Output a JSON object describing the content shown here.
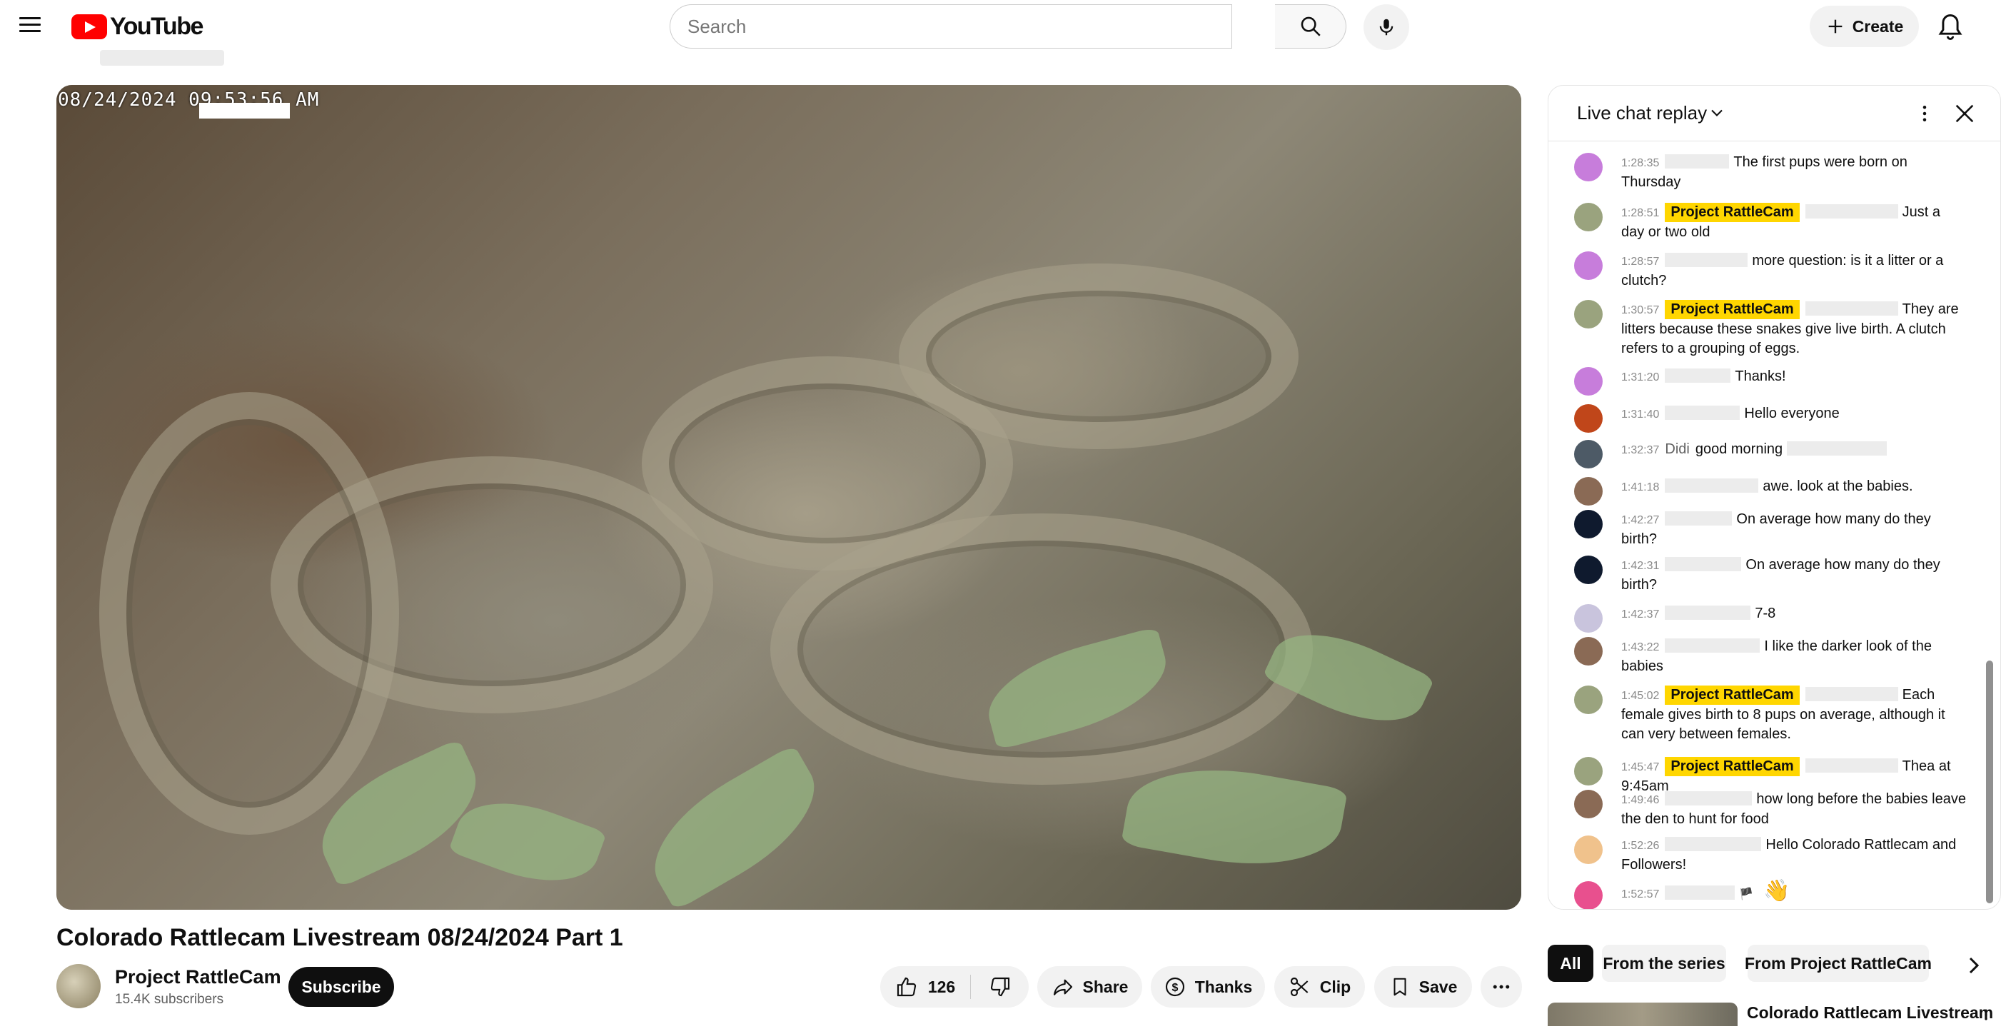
{
  "header": {
    "logo_text": "YouTube",
    "search_placeholder": "Search",
    "create_label": "Create"
  },
  "player": {
    "timestamp_overlay": "08/24/2024 09:53:56 AM"
  },
  "video": {
    "title": "Colorado Rattlecam Livestream 08/24/2024 Part 1",
    "channel_name": "Project RattleCam",
    "subscribers": "15.4K subscribers",
    "subscribe_label": "Subscribe",
    "like_count": "126",
    "share_label": "Share",
    "thanks_label": "Thanks",
    "clip_label": "Clip",
    "save_label": "Save"
  },
  "chat": {
    "title": "Live chat replay",
    "messages": [
      {
        "time": "1:28:35",
        "author": "",
        "moderator": false,
        "text": "The first pups were born on Thursday",
        "avatar_color": "#c77ddb"
      },
      {
        "time": "1:28:51",
        "author": "Project RattleCam",
        "moderator": true,
        "text": "Just a day or two old",
        "avatar_color": "#9aa37e"
      },
      {
        "time": "1:28:57",
        "author": "",
        "moderator": false,
        "text": "more question: is it a litter or a clutch?",
        "avatar_color": "#c77ddb"
      },
      {
        "time": "1:30:57",
        "author": "Project RattleCam",
        "moderator": true,
        "text": "They are litters because these snakes give live birth. A clutch refers to a grouping of eggs.",
        "avatar_color": "#9aa37e"
      },
      {
        "time": "1:31:20",
        "author": "",
        "moderator": false,
        "text": "Thanks!",
        "avatar_color": "#c77ddb"
      },
      {
        "time": "1:31:40",
        "author": "",
        "moderator": false,
        "text": "Hello everyone",
        "avatar_color": "#c0461a"
      },
      {
        "time": "1:32:37",
        "author": "Didi",
        "moderator": false,
        "text": "good morning",
        "avatar_color": "#4d5a66"
      },
      {
        "time": "1:41:18",
        "author": "",
        "moderator": false,
        "text": "awe. look at the babies.",
        "avatar_color": "#8a6a55"
      },
      {
        "time": "1:42:27",
        "author": "",
        "moderator": false,
        "text": "On average how many do they birth?",
        "avatar_color": "#0f1a2e"
      },
      {
        "time": "1:42:31",
        "author": "",
        "moderator": false,
        "text": "On average how many do they birth?",
        "avatar_color": "#0f1a2e"
      },
      {
        "time": "1:42:37",
        "author": "",
        "moderator": false,
        "text": "7-8",
        "avatar_color": "#c9c4dd"
      },
      {
        "time": "1:43:22",
        "author": "",
        "moderator": false,
        "text": "I like the darker look of the babies",
        "avatar_color": "#8a6a55"
      },
      {
        "time": "1:45:02",
        "author": "Project RattleCam",
        "moderator": true,
        "text": "Each female gives birth to 8 pups on average, although it can very between females.",
        "avatar_color": "#9aa37e"
      },
      {
        "time": "1:45:47",
        "author": "Project RattleCam",
        "moderator": true,
        "text": "Thea at 9:45am",
        "avatar_color": "#9aa37e"
      },
      {
        "time": "1:49:46",
        "author": "",
        "moderator": false,
        "text": "how long before the babies leave the den to hunt for food",
        "avatar_color": "#8a6a55"
      },
      {
        "time": "1:52:26",
        "author": "",
        "moderator": false,
        "text": "Hello Colorado Rattlecam and Followers!",
        "avatar_color": "#f0c28c"
      },
      {
        "time": "1:52:57",
        "author": "",
        "moderator": false,
        "text": "",
        "avatar_color": "#e8508e"
      }
    ]
  },
  "chips": [
    "All",
    "From the series",
    "From Project RattleCam"
  ],
  "related": {
    "first_title": "Colorado Rattlecam Livestream"
  }
}
